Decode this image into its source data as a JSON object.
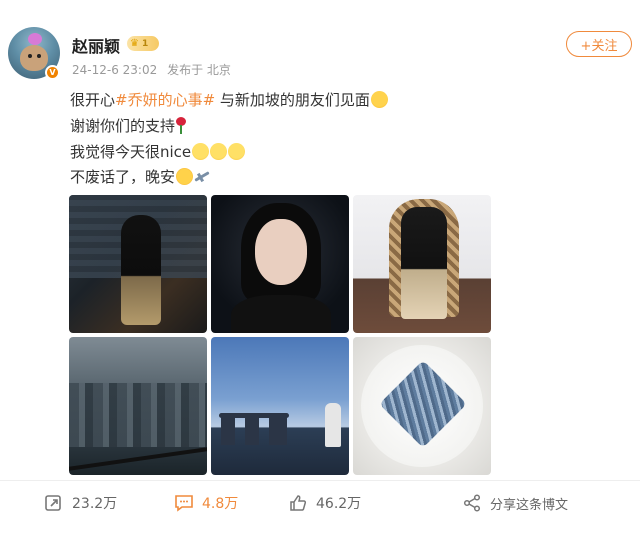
{
  "user": {
    "name": "赵丽颖",
    "level_badge": "1",
    "verified_badge": "V",
    "timestamp": "24-12-6 23:02",
    "location": "发布于 北京",
    "follow_label": "+关注"
  },
  "post": {
    "line1_prefix": "很开心",
    "line1_tag": "#乔妍的心事#",
    "line1_suffix": " 与新加坡的朋友们见面",
    "line2": "谢谢你们的支持",
    "line3": "我觉得今天很nice",
    "line4": "不废话了，晚安"
  },
  "photos": [
    {
      "name": "photo-staircase-black-dress"
    },
    {
      "name": "photo-portrait-closeup"
    },
    {
      "name": "photo-seated-chair"
    },
    {
      "name": "photo-window-city-view"
    },
    {
      "name": "photo-marina-bay-sands"
    },
    {
      "name": "photo-blue-cake-on-plate"
    }
  ],
  "actions": {
    "repost_count": "23.2万",
    "comment_count": "4.8万",
    "like_count": "46.2万",
    "share_label": "分享这条博文"
  },
  "colors": {
    "accent": "#f08a3c",
    "verified": "#f08200",
    "text": "#333333",
    "meta": "#999999"
  },
  "icons": [
    "repost-icon",
    "comment-icon",
    "like-icon",
    "share-icon"
  ]
}
